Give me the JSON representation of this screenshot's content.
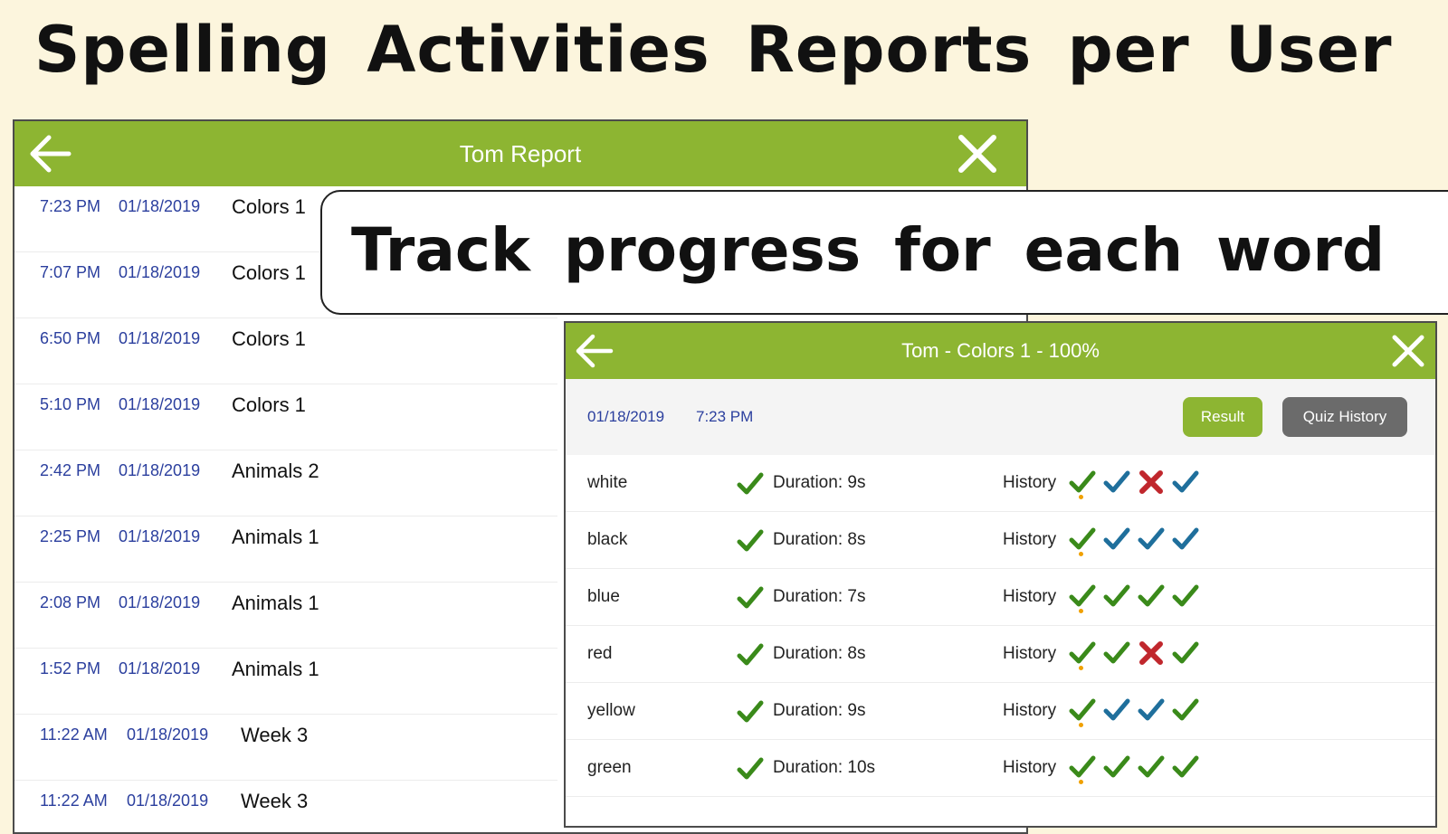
{
  "headline": "Spelling Activities Reports per User",
  "report_panel": {
    "title": "Tom Report",
    "rows": [
      {
        "time": "7:23 PM",
        "date": "01/18/2019",
        "activity": "Colors 1"
      },
      {
        "time": "7:07 PM",
        "date": "01/18/2019",
        "activity": "Colors 1"
      },
      {
        "time": "6:50 PM",
        "date": "01/18/2019",
        "activity": "Colors 1"
      },
      {
        "time": "5:10 PM",
        "date": "01/18/2019",
        "activity": "Colors 1"
      },
      {
        "time": "2:42 PM",
        "date": "01/18/2019",
        "activity": "Animals 2"
      },
      {
        "time": "2:25 PM",
        "date": "01/18/2019",
        "activity": "Animals 1"
      },
      {
        "time": "2:08 PM",
        "date": "01/18/2019",
        "activity": "Animals 1"
      },
      {
        "time": "1:52 PM",
        "date": "01/18/2019",
        "activity": "Animals 1"
      },
      {
        "time": "11:22 AM",
        "date": "01/18/2019",
        "activity": "Week 3"
      },
      {
        "time": "11:22 AM",
        "date": "01/18/2019",
        "activity": "Week 3"
      }
    ]
  },
  "callout": "Track progress for each word",
  "detail_panel": {
    "title": "Tom - Colors 1 - 100%",
    "date": "01/18/2019",
    "time": "7:23 PM",
    "result_button": "Result",
    "quiz_history_button": "Quiz History",
    "history_label": "History",
    "words": [
      {
        "word": "white",
        "duration": "Duration: 9s",
        "history": [
          "green",
          "blue",
          "red",
          "blue"
        ]
      },
      {
        "word": "black",
        "duration": "Duration: 8s",
        "history": [
          "green",
          "blue",
          "blue",
          "blue"
        ]
      },
      {
        "word": "blue",
        "duration": "Duration: 7s",
        "history": [
          "green",
          "green",
          "green",
          "green"
        ]
      },
      {
        "word": "red",
        "duration": "Duration: 8s",
        "history": [
          "green",
          "green",
          "red",
          "green"
        ]
      },
      {
        "word": "yellow",
        "duration": "Duration: 9s",
        "history": [
          "green",
          "blue",
          "blue",
          "green"
        ]
      },
      {
        "word": "green",
        "duration": "Duration: 10s",
        "history": [
          "green",
          "green",
          "green",
          "green"
        ]
      }
    ]
  },
  "colors": {
    "green_bar": "#8db532",
    "mark_green": "#3a8a1a",
    "mark_blue": "#1f6f9c",
    "mark_red": "#c0272d",
    "link_blue": "#2b3f9e"
  }
}
